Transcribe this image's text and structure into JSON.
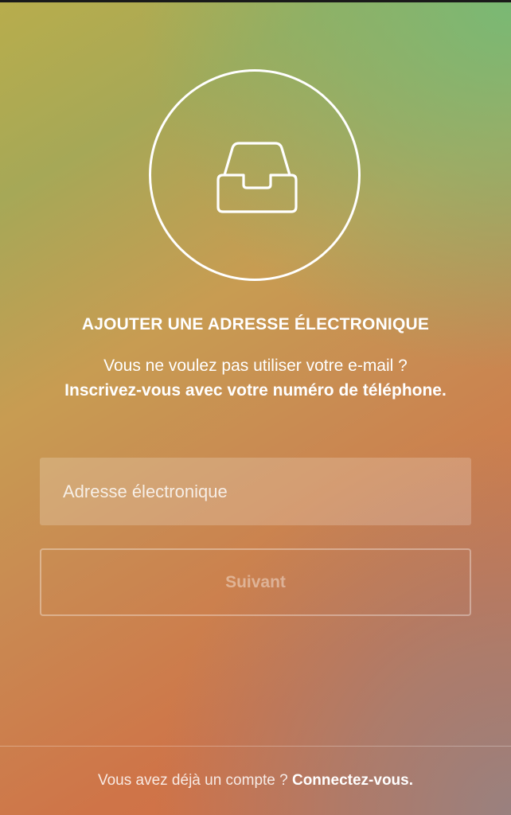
{
  "header": {
    "icon": "inbox-tray-icon",
    "title": "AJOUTER UNE ADRESSE ÉLECTRONIQUE",
    "subtitle_text": "Vous ne voulez pas utiliser votre e-mail ?",
    "phone_signup_link": "Inscrivez-vous avec votre numéro de téléphone."
  },
  "form": {
    "email_placeholder": "Adresse électronique",
    "email_value": "",
    "next_label": "Suivant"
  },
  "footer": {
    "prompt_text": "Vous avez déjà un compte ?",
    "login_link": "Connectez-vous."
  },
  "colors": {
    "text": "#ffffff",
    "gradient_top_left": "#b8ad4c",
    "gradient_top_right": "#76ba76",
    "gradient_bottom_left": "#d36c44",
    "gradient_bottom_right": "#968282"
  }
}
